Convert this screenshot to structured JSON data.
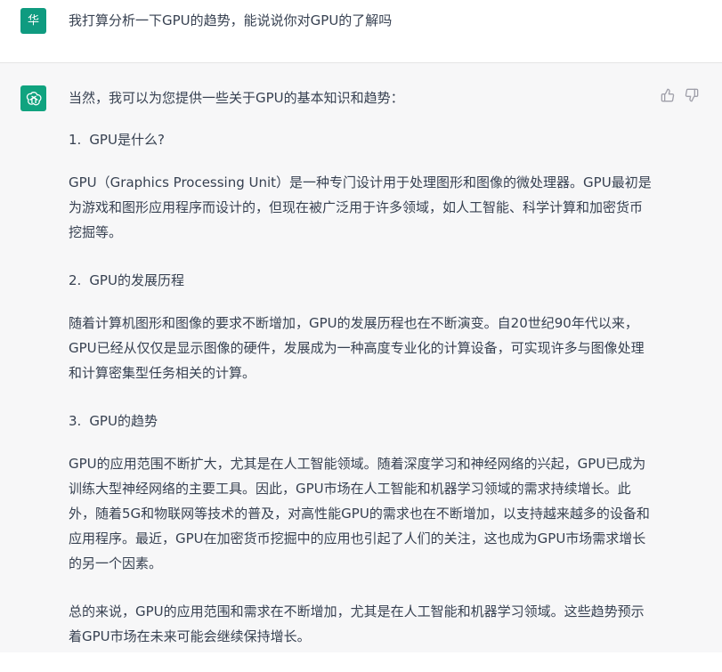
{
  "user": {
    "avatar_text": "华",
    "message": "我打算分析一下GPU的趋势，能说说你对GPU的了解吗"
  },
  "assistant": {
    "intro": "当然，我可以为您提供一些关于GPU的基本知识和趋势：",
    "sections": [
      {
        "number": "1.",
        "title": "GPU是什么?",
        "paragraphs": [
          "GPU（Graphics Processing Unit）是一种专门设计用于处理图形和图像的微处理器。GPU最初是为游戏和图形应用程序而设计的，但现在被广泛用于许多领域，如人工智能、科学计算和加密货币挖掘等。"
        ]
      },
      {
        "number": "2.",
        "title": "GPU的发展历程",
        "paragraphs": [
          "随着计算机图形和图像的要求不断增加，GPU的发展历程也在不断演变。自20世纪90年代以来，GPU已经从仅仅是显示图像的硬件，发展成为一种高度专业化的计算设备，可实现许多与图像处理和计算密集型任务相关的计算。"
        ]
      },
      {
        "number": "3.",
        "title": "GPU的趋势",
        "paragraphs": [
          "GPU的应用范围不断扩大，尤其是在人工智能领域。随着深度学习和神经网络的兴起，GPU已成为训练大型神经网络的主要工具。因此，GPU市场在人工智能和机器学习领域的需求持续增长。此外，随着5G和物联网等技术的普及，对高性能GPU的需求也在不断增加，以支持越来越多的设备和应用程序。最近，GPU在加密货币挖掘中的应用也引起了人们的关注，这也成为GPU市场需求增长的另一个因素。",
          "总的来说，GPU的应用范围和需求在不断增加，尤其是在人工智能和机器学习领域。这些趋势预示着GPU市场在未来可能会继续保持增长。"
        ]
      }
    ]
  },
  "icons": {
    "assistant_logo": "openai-logo-icon",
    "like": "thumbs-up-icon",
    "dislike": "thumbs-down-icon"
  },
  "colors": {
    "user_avatar_bg": "#0f9b80",
    "assistant_avatar_bg": "#10a37f",
    "assistant_row_bg": "#f7f7f8",
    "text": "#374151"
  }
}
